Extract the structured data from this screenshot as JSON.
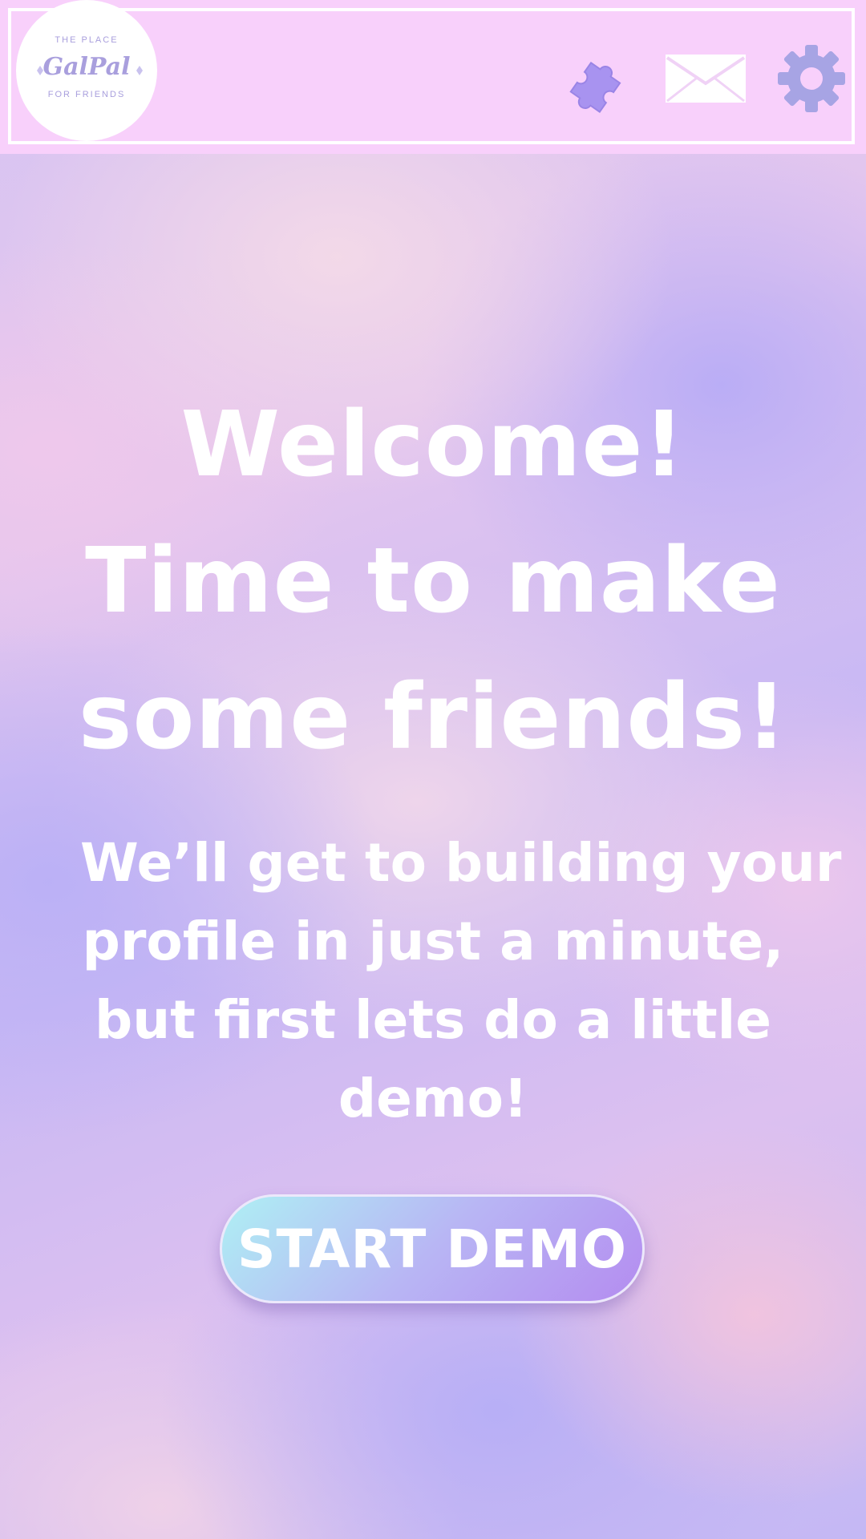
{
  "header": {
    "logo": {
      "brand": "GalPal",
      "tagline_top": "THE PLACE",
      "tagline_bottom": "FOR FRIENDS"
    },
    "icons": [
      "puzzle-icon",
      "mail-icon",
      "gear-icon"
    ]
  },
  "main": {
    "headline": [
      "Welcome!",
      "Time to make",
      "some friends!"
    ],
    "subtext": [
      "We’ll get to building your",
      "profile in just a minute,",
      "but first lets do a little",
      "demo!"
    ],
    "start_button_label": "START DEMO"
  },
  "colors": {
    "header_bg": "#f8d0fb",
    "accent_lavender": "#a99fdd",
    "puzzle": "#a893f0",
    "button_gradient": [
      "#aef0f4",
      "#b8b6f4",
      "#b48cf0"
    ]
  }
}
